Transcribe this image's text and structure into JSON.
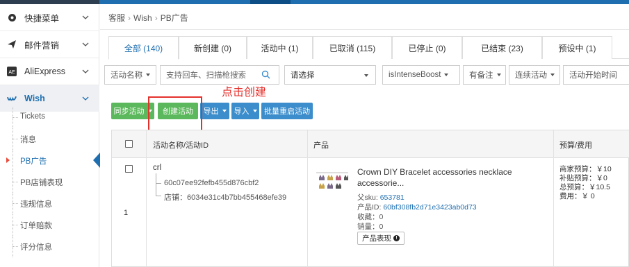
{
  "sidebar": {
    "menu": [
      {
        "label": "快捷菜单",
        "icon": "dashboard-icon"
      },
      {
        "label": "邮件营销",
        "icon": "send-icon"
      },
      {
        "label": "AliExpress",
        "icon": "aliexpress-logo-icon"
      },
      {
        "label": "Wish",
        "icon": "wish-logo-icon"
      }
    ],
    "wish_submenu": [
      "Tickets",
      "消息",
      "PB广告",
      "PB店铺表现",
      "违规信息",
      "订单赔款",
      "评分信息"
    ]
  },
  "breadcrumb": [
    "客服",
    "Wish",
    "PB广告"
  ],
  "tabs": [
    "全部 (140)",
    "新创建 (0)",
    "活动中 (1)",
    "已取消 (115)",
    "已停止 (0)",
    "已结束 (23)",
    "预设中 (1)"
  ],
  "filters": {
    "field_select": "活动名称",
    "search_placeholder": "支持回车、扫描枪搜索",
    "status_select": "请选择",
    "intense_boost": "isIntenseBoost",
    "remark": "有备注",
    "continuous": "连续活动",
    "start_time": "活动开始时间"
  },
  "annotation": "点击创建",
  "actions": {
    "sync": "同步活动",
    "create": "创建活动",
    "export": "导出",
    "import": "导入",
    "batch_restart": "批量重启活动"
  },
  "table": {
    "headers": {
      "name": "活动名称/活动ID",
      "product": "产品",
      "budget": "预算/费用"
    },
    "rows": [
      {
        "index": "1",
        "name": "crl",
        "campaign_id": "60c07ee92fefb455d876cbf2",
        "store": "店铺：6034e31c4b7bb455468efe39",
        "product_title": "Crown DIY Bracelet accessories necklace accessorie...",
        "parent_sku_label": "父sku:",
        "parent_sku": "653781",
        "product_id_label": "产品ID:",
        "product_id": "60bf308fb2d71e3423ab0d73",
        "favorites": "收藏：0",
        "sales": "销量：0",
        "perf_button": "产品表现",
        "merchant_budget": "商家预算：￥10",
        "subsidy_budget": "补贴预算：￥0",
        "total_budget": "总预算：￥10.5",
        "cost": "费用：￥ 0"
      }
    ]
  },
  "colors": {
    "primary": "#1f6fb0",
    "green": "#5cb85c",
    "blue_btn": "#3c8dcb",
    "annotation_red": "#e4302b"
  }
}
